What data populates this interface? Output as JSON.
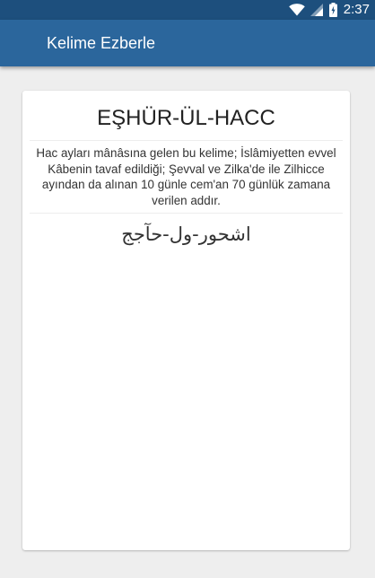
{
  "status_bar": {
    "time": "2:37",
    "icons": [
      "wifi-icon",
      "signal-icon",
      "battery-icon"
    ]
  },
  "app_bar": {
    "title": "Kelime Ezberle"
  },
  "card": {
    "word": "EŞHÜR-ÜL-HACC",
    "definition": "Hac ayları mânâsına gelen bu kelime; İslâmiyetten evvel Kâbenin tavaf edildiği; Şevval ve Zilka'de ile Zilhicce ayından da alınan 10 günle cem'an 70 günlük zamana verilen addır.",
    "arabic": "اشحور-ول-حآجج"
  },
  "colors": {
    "status_bar": "#1d4f7d",
    "app_bar": "#2b669c",
    "background": "#eeeeee",
    "card": "#ffffff"
  }
}
